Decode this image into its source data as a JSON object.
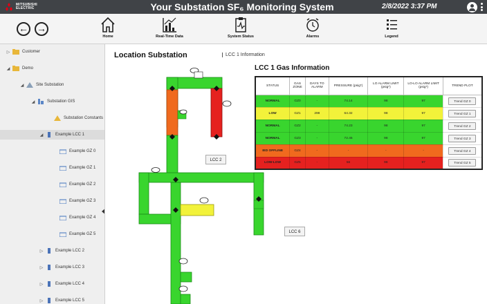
{
  "app": {
    "logo_text": [
      "MITSUBISHI",
      "ELECTRIC"
    ],
    "title": "Your Substation SF₆ Monitoring System",
    "datetime": "2/8/2022 3:37 PM"
  },
  "toolbar": {
    "back_icon": "←",
    "forward_icon": "→",
    "tools": [
      {
        "label": "Home",
        "icon": "home-icon"
      },
      {
        "label": "Real-Time Data",
        "icon": "chart-icon"
      },
      {
        "label": "System Status",
        "icon": "status-icon"
      },
      {
        "label": "Alarms",
        "icon": "alarm-icon"
      },
      {
        "label": "Legend",
        "icon": "legend-icon"
      }
    ]
  },
  "sidebar": {
    "items": [
      {
        "label": "Customer",
        "arrow": "▷"
      },
      {
        "label": "Demo",
        "arrow": "◢"
      },
      {
        "label": "Site Substation",
        "arrow": "◢"
      },
      {
        "label": "Substation GIS",
        "arrow": "◢"
      },
      {
        "label": "Substation Constants",
        "arrow": ""
      },
      {
        "label": "Example LCC 1",
        "arrow": "◢"
      },
      {
        "label": "Example GZ 0",
        "arrow": ""
      },
      {
        "label": "Example GZ 1",
        "arrow": ""
      },
      {
        "label": "Example GZ 2",
        "arrow": ""
      },
      {
        "label": "Example GZ 3",
        "arrow": ""
      },
      {
        "label": "Example GZ 4",
        "arrow": ""
      },
      {
        "label": "Example GZ 5",
        "arrow": ""
      },
      {
        "label": "Example LCC 2",
        "arrow": "▷"
      },
      {
        "label": "Example LCC 3",
        "arrow": "▷"
      },
      {
        "label": "Example LCC 4",
        "arrow": "▷"
      },
      {
        "label": "Example LCC 5",
        "arrow": "▷"
      }
    ]
  },
  "main": {
    "location_title": "Location Substation",
    "breadcrumb": "LCC 1 Information",
    "gas_info_title": "LCC 1 Gas Information",
    "table": {
      "headers": [
        "STATUS",
        "GAS ZONE",
        "DAYS TO ALARM",
        "PRESSURE (psig*)",
        "LO ALARM LIMIT (psig*)",
        "LO-LO ALARM LIMIT (psig*)",
        "TREND PLOT"
      ],
      "rows": [
        {
          "status": "NORMAL",
          "zone": "GZ0",
          "days": "-",
          "pressure": "74.14",
          "lo": "98",
          "lolo": "97",
          "trend": "Trend GZ 0",
          "color": "#39d52e"
        },
        {
          "status": "LOW",
          "zone": "GZ1",
          "days": "298",
          "pressure": "64.32",
          "lo": "98",
          "lolo": "97",
          "trend": "Trend GZ 1",
          "color": "#f2f23a"
        },
        {
          "status": "NORMAL",
          "zone": "GZ2",
          "days": "-",
          "pressure": "74.23",
          "lo": "98",
          "lolo": "97",
          "trend": "Trend GZ 2",
          "color": "#39d52e"
        },
        {
          "status": "NORMAL",
          "zone": "GZ3",
          "days": "-",
          "pressure": "72.45",
          "lo": "98",
          "lolo": "97",
          "trend": "Trend GZ 3",
          "color": "#39d52e"
        },
        {
          "status": "IED OFFLINE",
          "zone": "GZ4",
          "days": "-",
          "pressure": "-",
          "lo": "-",
          "lolo": "-",
          "trend": "Trend GZ 4",
          "color": "#f06a1e"
        },
        {
          "status": "LOW-LOW",
          "zone": "GZ5",
          "days": "-",
          "pressure": "56",
          "lo": "98",
          "lolo": "97",
          "trend": "Trend GZ 5",
          "color": "#e5211f"
        }
      ]
    },
    "lcc_buttons": [
      "LCC 2",
      "LCC 6"
    ]
  },
  "colors": {
    "normal": "#39d52e",
    "low": "#f2f23a",
    "offline": "#f06a1e",
    "lowlow": "#e5211f",
    "titlebar": "#404347"
  }
}
